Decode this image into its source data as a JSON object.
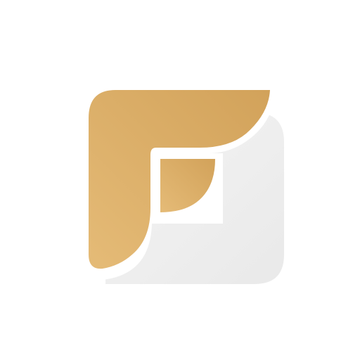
{
  "logo": {
    "name": "F letter logo",
    "icon": "letter-f-logo-icon",
    "colors": {
      "background": "#ffffff",
      "tile_base": "#f4f4f4",
      "tile_shadow": "#e9e9e9",
      "outline": "#ffffff",
      "gold_light": "#e5bb77",
      "gold_dark": "#d2a25a"
    }
  }
}
